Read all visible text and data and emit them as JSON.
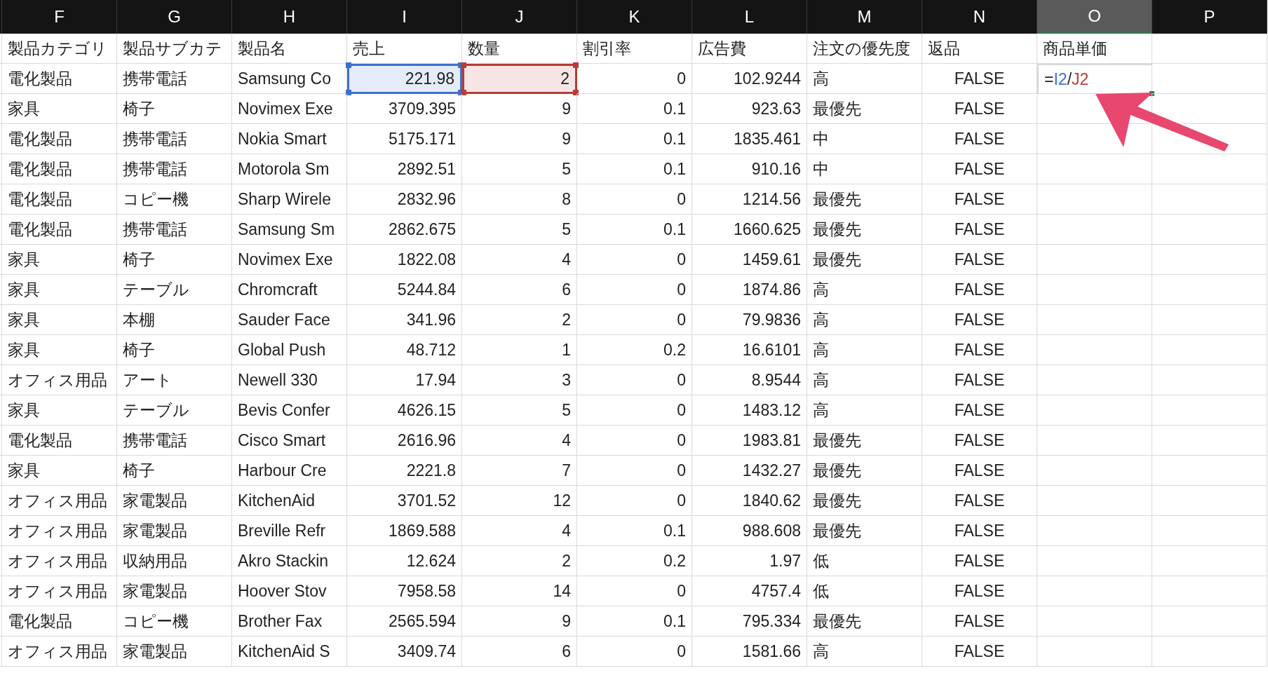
{
  "columns": [
    {
      "letter": "F",
      "selected": false,
      "kind": "text"
    },
    {
      "letter": "G",
      "selected": false,
      "kind": "text"
    },
    {
      "letter": "H",
      "selected": false,
      "kind": "text"
    },
    {
      "letter": "I",
      "selected": false,
      "kind": "number"
    },
    {
      "letter": "J",
      "selected": false,
      "kind": "number"
    },
    {
      "letter": "K",
      "selected": false,
      "kind": "number"
    },
    {
      "letter": "L",
      "selected": false,
      "kind": "number"
    },
    {
      "letter": "M",
      "selected": false,
      "kind": "text"
    },
    {
      "letter": "N",
      "selected": false,
      "kind": "boolean"
    },
    {
      "letter": "O",
      "selected": true,
      "kind": "number"
    },
    {
      "letter": "P",
      "selected": false,
      "kind": "text"
    }
  ],
  "column_names": [
    "製品カテゴリ",
    "製品サブカテ",
    "製品名",
    "売上",
    "数量",
    "割引率",
    "広告費",
    "注文の優先度",
    "返品",
    "商品単価"
  ],
  "rows": [
    {
      "cells": [
        {
          "text": "電化製品"
        },
        {
          "text": "携帯電話"
        },
        {
          "text": "Samsung Co"
        },
        {
          "text": "221.98",
          "color": "#3d6fd1"
        },
        {
          "text": "2",
          "color": "#b83b34"
        },
        {
          "text": "0"
        },
        {
          "text": "102.9244"
        },
        {
          "text": "高"
        },
        {
          "text": "FALSE"
        },
        {
          "formula": [
            {
              "text": "=",
              "color": "#1f1f1f"
            },
            {
              "text": "I2",
              "color": "#3d6fd1"
            },
            {
              "text": "/",
              "color": "#1f1f1f"
            },
            {
              "text": "J2",
              "color": "#b83b34"
            }
          ]
        }
      ]
    },
    {
      "cells": [
        {
          "text": "家具"
        },
        {
          "text": "椅子"
        },
        {
          "text": "Novimex Exe"
        },
        {
          "text": "3709.395"
        },
        {
          "text": "9"
        },
        {
          "text": "0.1"
        },
        {
          "text": "923.63"
        },
        {
          "text": "最優先"
        },
        {
          "text": "FALSE"
        }
      ]
    },
    {
      "cells": [
        {
          "text": "電化製品"
        },
        {
          "text": "携帯電話"
        },
        {
          "text": "Nokia Smart"
        },
        {
          "text": "5175.171"
        },
        {
          "text": "9"
        },
        {
          "text": "0.1"
        },
        {
          "text": "1835.461"
        },
        {
          "text": "中"
        },
        {
          "text": "FALSE"
        }
      ]
    },
    {
      "cells": [
        {
          "text": "電化製品"
        },
        {
          "text": "携帯電話"
        },
        {
          "text": "Motorola Sm"
        },
        {
          "text": "2892.51"
        },
        {
          "text": "5"
        },
        {
          "text": "0.1"
        },
        {
          "text": "910.16"
        },
        {
          "text": "中"
        },
        {
          "text": "FALSE"
        }
      ]
    },
    {
      "cells": [
        {
          "text": "電化製品"
        },
        {
          "text": "コピー機"
        },
        {
          "text": "Sharp Wirele"
        },
        {
          "text": "2832.96"
        },
        {
          "text": "8"
        },
        {
          "text": "0"
        },
        {
          "text": "1214.56"
        },
        {
          "text": "最優先"
        },
        {
          "text": "FALSE"
        }
      ]
    },
    {
      "cells": [
        {
          "text": "電化製品"
        },
        {
          "text": "携帯電話"
        },
        {
          "text": "Samsung Sm"
        },
        {
          "text": "2862.675"
        },
        {
          "text": "5"
        },
        {
          "text": "0.1"
        },
        {
          "text": "1660.625"
        },
        {
          "text": "最優先"
        },
        {
          "text": "FALSE"
        }
      ]
    },
    {
      "cells": [
        {
          "text": "家具"
        },
        {
          "text": "椅子"
        },
        {
          "text": "Novimex Exe"
        },
        {
          "text": "1822.08"
        },
        {
          "text": "4"
        },
        {
          "text": "0"
        },
        {
          "text": "1459.61"
        },
        {
          "text": "最優先"
        },
        {
          "text": "FALSE"
        }
      ]
    },
    {
      "cells": [
        {
          "text": "家具"
        },
        {
          "text": "テーブル"
        },
        {
          "text": "Chromcraft"
        },
        {
          "text": "5244.84"
        },
        {
          "text": "6"
        },
        {
          "text": "0"
        },
        {
          "text": "1874.86"
        },
        {
          "text": "高"
        },
        {
          "text": "FALSE"
        }
      ]
    },
    {
      "cells": [
        {
          "text": "家具"
        },
        {
          "text": "本棚"
        },
        {
          "text": "Sauder Face"
        },
        {
          "text": "341.96"
        },
        {
          "text": "2"
        },
        {
          "text": "0"
        },
        {
          "text": "79.9836"
        },
        {
          "text": "高"
        },
        {
          "text": "FALSE"
        }
      ]
    },
    {
      "cells": [
        {
          "text": "家具"
        },
        {
          "text": "椅子"
        },
        {
          "text": "Global Push"
        },
        {
          "text": "48.712"
        },
        {
          "text": "1"
        },
        {
          "text": "0.2"
        },
        {
          "text": "16.6101"
        },
        {
          "text": "高"
        },
        {
          "text": "FALSE"
        }
      ]
    },
    {
      "cells": [
        {
          "text": "オフィス用品"
        },
        {
          "text": "アート"
        },
        {
          "text": "Newell 330"
        },
        {
          "text": "17.94"
        },
        {
          "text": "3"
        },
        {
          "text": "0"
        },
        {
          "text": "8.9544"
        },
        {
          "text": "高"
        },
        {
          "text": "FALSE"
        }
      ]
    },
    {
      "cells": [
        {
          "text": "家具"
        },
        {
          "text": "テーブル"
        },
        {
          "text": "Bevis Confer"
        },
        {
          "text": "4626.15"
        },
        {
          "text": "5"
        },
        {
          "text": "0"
        },
        {
          "text": "1483.12"
        },
        {
          "text": "高"
        },
        {
          "text": "FALSE"
        }
      ]
    },
    {
      "cells": [
        {
          "text": "電化製品"
        },
        {
          "text": "携帯電話"
        },
        {
          "text": "Cisco Smart"
        },
        {
          "text": "2616.96"
        },
        {
          "text": "4"
        },
        {
          "text": "0"
        },
        {
          "text": "1983.81"
        },
        {
          "text": "最優先"
        },
        {
          "text": "FALSE"
        }
      ]
    },
    {
      "cells": [
        {
          "text": "家具"
        },
        {
          "text": "椅子"
        },
        {
          "text": "Harbour Cre"
        },
        {
          "text": "2221.8"
        },
        {
          "text": "7"
        },
        {
          "text": "0"
        },
        {
          "text": "1432.27"
        },
        {
          "text": "最優先"
        },
        {
          "text": "FALSE"
        }
      ]
    },
    {
      "cells": [
        {
          "text": "オフィス用品"
        },
        {
          "text": "家電製品"
        },
        {
          "text": "KitchenAid"
        },
        {
          "text": "3701.52"
        },
        {
          "text": "12"
        },
        {
          "text": "0"
        },
        {
          "text": "1840.62"
        },
        {
          "text": "最優先"
        },
        {
          "text": "FALSE"
        }
      ]
    },
    {
      "cells": [
        {
          "text": "オフィス用品"
        },
        {
          "text": "家電製品"
        },
        {
          "text": "Breville Refr"
        },
        {
          "text": "1869.588"
        },
        {
          "text": "4"
        },
        {
          "text": "0.1"
        },
        {
          "text": "988.608"
        },
        {
          "text": "最優先"
        },
        {
          "text": "FALSE"
        }
      ]
    },
    {
      "cells": [
        {
          "text": "オフィス用品"
        },
        {
          "text": "収納用品"
        },
        {
          "text": "Akro Stackin"
        },
        {
          "text": "12.624"
        },
        {
          "text": "2"
        },
        {
          "text": "0.2"
        },
        {
          "text": "1.97"
        },
        {
          "text": "低"
        },
        {
          "text": "FALSE"
        }
      ]
    },
    {
      "cells": [
        {
          "text": "オフィス用品"
        },
        {
          "text": "家電製品"
        },
        {
          "text": "Hoover Stov"
        },
        {
          "text": "7958.58"
        },
        {
          "text": "14"
        },
        {
          "text": "0"
        },
        {
          "text": "4757.4"
        },
        {
          "text": "低"
        },
        {
          "text": "FALSE"
        }
      ]
    },
    {
      "cells": [
        {
          "text": "電化製品"
        },
        {
          "text": "コピー機"
        },
        {
          "text": "Brother Fax"
        },
        {
          "text": "2565.594"
        },
        {
          "text": "9"
        },
        {
          "text": "0.1"
        },
        {
          "text": "795.334"
        },
        {
          "text": "最優先"
        },
        {
          "text": "FALSE"
        }
      ]
    },
    {
      "cells": [
        {
          "text": "オフィス用品"
        },
        {
          "text": "家電製品"
        },
        {
          "text": "KitchenAid S"
        },
        {
          "text": "3409.74"
        },
        {
          "text": "6"
        },
        {
          "text": "0"
        },
        {
          "text": "1581.66"
        },
        {
          "text": "高"
        },
        {
          "text": "FALSE"
        }
      ]
    }
  ]
}
